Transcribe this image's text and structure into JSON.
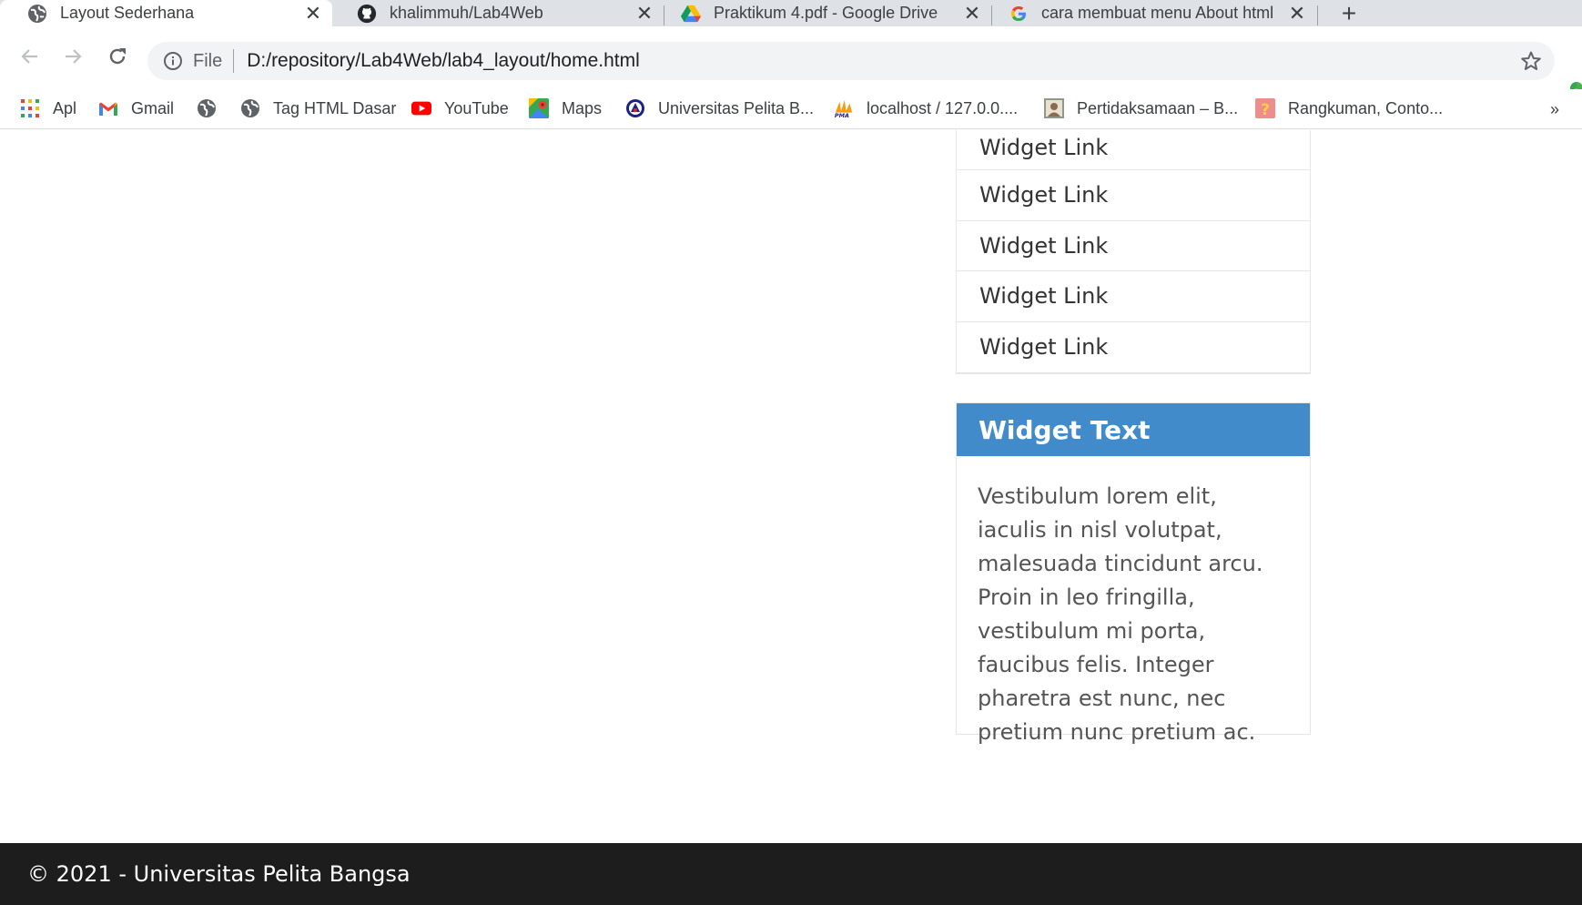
{
  "browser": {
    "tabs": [
      {
        "title": "Layout Sederhana",
        "icon": "globe-icon",
        "active": true
      },
      {
        "title": "khalimmuh/Lab4Web",
        "icon": "github-icon",
        "active": false
      },
      {
        "title": "Praktikum 4.pdf - Google Drive",
        "icon": "google-drive-icon",
        "active": false
      },
      {
        "title": "cara membuat menu About html",
        "icon": "google-icon",
        "active": false
      }
    ],
    "close_glyph": "✕",
    "new_tab_glyph": "+",
    "address": {
      "scheme_label": "File",
      "url": "D:/repository/Lab4Web/lab4_layout/home.html"
    },
    "bookmarks": [
      {
        "label": "Apl",
        "icon": "apps-grid-icon"
      },
      {
        "label": "Gmail",
        "icon": "gmail-icon"
      },
      {
        "label": "",
        "icon": "globe-icon"
      },
      {
        "label": "Tag HTML Dasar",
        "icon": "globe-icon"
      },
      {
        "label": "YouTube",
        "icon": "youtube-icon"
      },
      {
        "label": "Maps",
        "icon": "maps-icon"
      },
      {
        "label": "Universitas Pelita B...",
        "icon": "university-icon"
      },
      {
        "label": "localhost / 127.0.0....",
        "icon": "phpmyadmin-icon"
      },
      {
        "label": "Pertidaksamaan – B...",
        "icon": "portrait-icon"
      },
      {
        "label": "Rangkuman, Conto...",
        "icon": "question-icon"
      }
    ],
    "bookmarks_more": "»"
  },
  "page": {
    "widget_links": [
      "Widget Link",
      "Widget Link",
      "Widget Link",
      "Widget Link",
      "Widget Link"
    ],
    "widget_text": {
      "title": "Widget Text",
      "body": "Vestibulum lorem elit, iaculis in nisl volutpat, malesuada tincidunt arcu. Proin in leo fringilla, vestibulum mi porta, faucibus felis. Integer pharetra est nunc, nec pretium nunc pretium ac."
    },
    "footer": "© 2021 - Universitas Pelita Bangsa"
  },
  "colors": {
    "widget_header": "#428bca",
    "footer_bg": "#1d1d1d",
    "tabstrip_bg": "#dee1e6"
  }
}
